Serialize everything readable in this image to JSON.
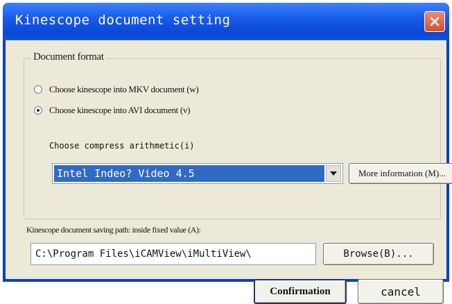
{
  "window": {
    "title": "Kinescope document setting",
    "close_icon": "close-icon"
  },
  "format_group": {
    "legend": "Document format",
    "options": [
      {
        "label": "Choose kinescope into MKV document (w)",
        "checked": false
      },
      {
        "label": "Choose kinescope into AVI document (v)",
        "checked": true
      }
    ],
    "compress_label": "Choose compress arithmetic(i)",
    "compress_value": "Intel Indeo? Video 4.5",
    "more_button": "More information (M)..."
  },
  "path": {
    "label": "Kinescope document saving path: inside fixed value (A):",
    "value": "C:\\Program Files\\iCAMView\\iMultiView\\",
    "browse_button": "Browse(B)..."
  },
  "buttons": {
    "confirm": "Confirmation",
    "cancel": "cancel"
  }
}
